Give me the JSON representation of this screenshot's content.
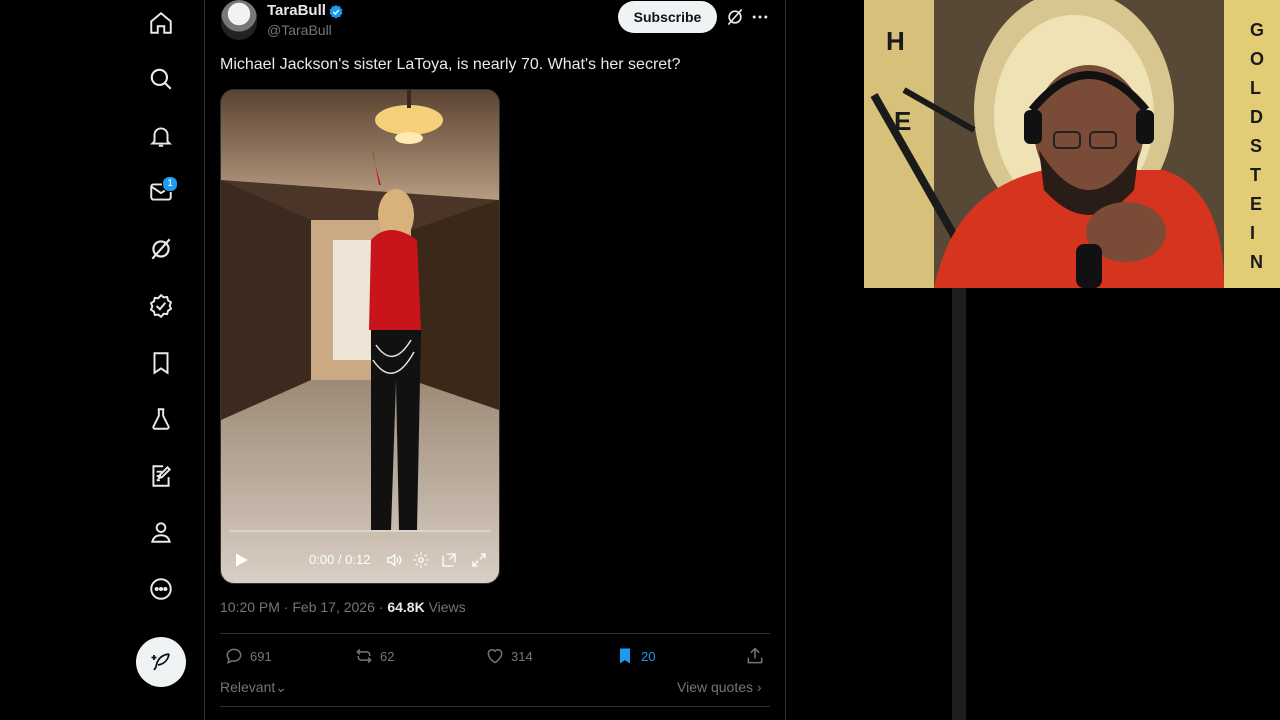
{
  "nav": {
    "items": [
      {
        "name": "home"
      },
      {
        "name": "explore"
      },
      {
        "name": "notifications"
      },
      {
        "name": "messages",
        "badge": "1"
      },
      {
        "name": "grok"
      },
      {
        "name": "verified"
      },
      {
        "name": "bookmarks"
      },
      {
        "name": "labs"
      },
      {
        "name": "articles"
      },
      {
        "name": "profile"
      },
      {
        "name": "more"
      }
    ]
  },
  "tweet": {
    "author_name": "TaraBull",
    "author_handle": "@TaraBull",
    "subscribe_label": "Subscribe",
    "text": "Michael Jackson's sister LaToya, is nearly 70. What's her secret?",
    "video": {
      "time": "0:00 / 0:12",
      "progress": 0
    },
    "timestamp": "10:20 PM · Feb 17, 2026 · ",
    "views_count": "64.8K",
    "views_label": " Views",
    "stats": {
      "replies": "691",
      "reposts": "62",
      "likes": "314",
      "bookmarks": "20"
    },
    "sort_label": "Relevant",
    "view_quotes_label": "View quotes"
  },
  "webcam": {
    "banner_left": [
      "H",
      "E"
    ],
    "banner_right": [
      "G",
      "O",
      "L",
      "D",
      "S",
      "T",
      "E",
      "I",
      "N"
    ]
  },
  "colors": {
    "accent": "#1d9bf0",
    "background": "#000000",
    "text": "#e7e9ea",
    "muted": "#71767b"
  }
}
